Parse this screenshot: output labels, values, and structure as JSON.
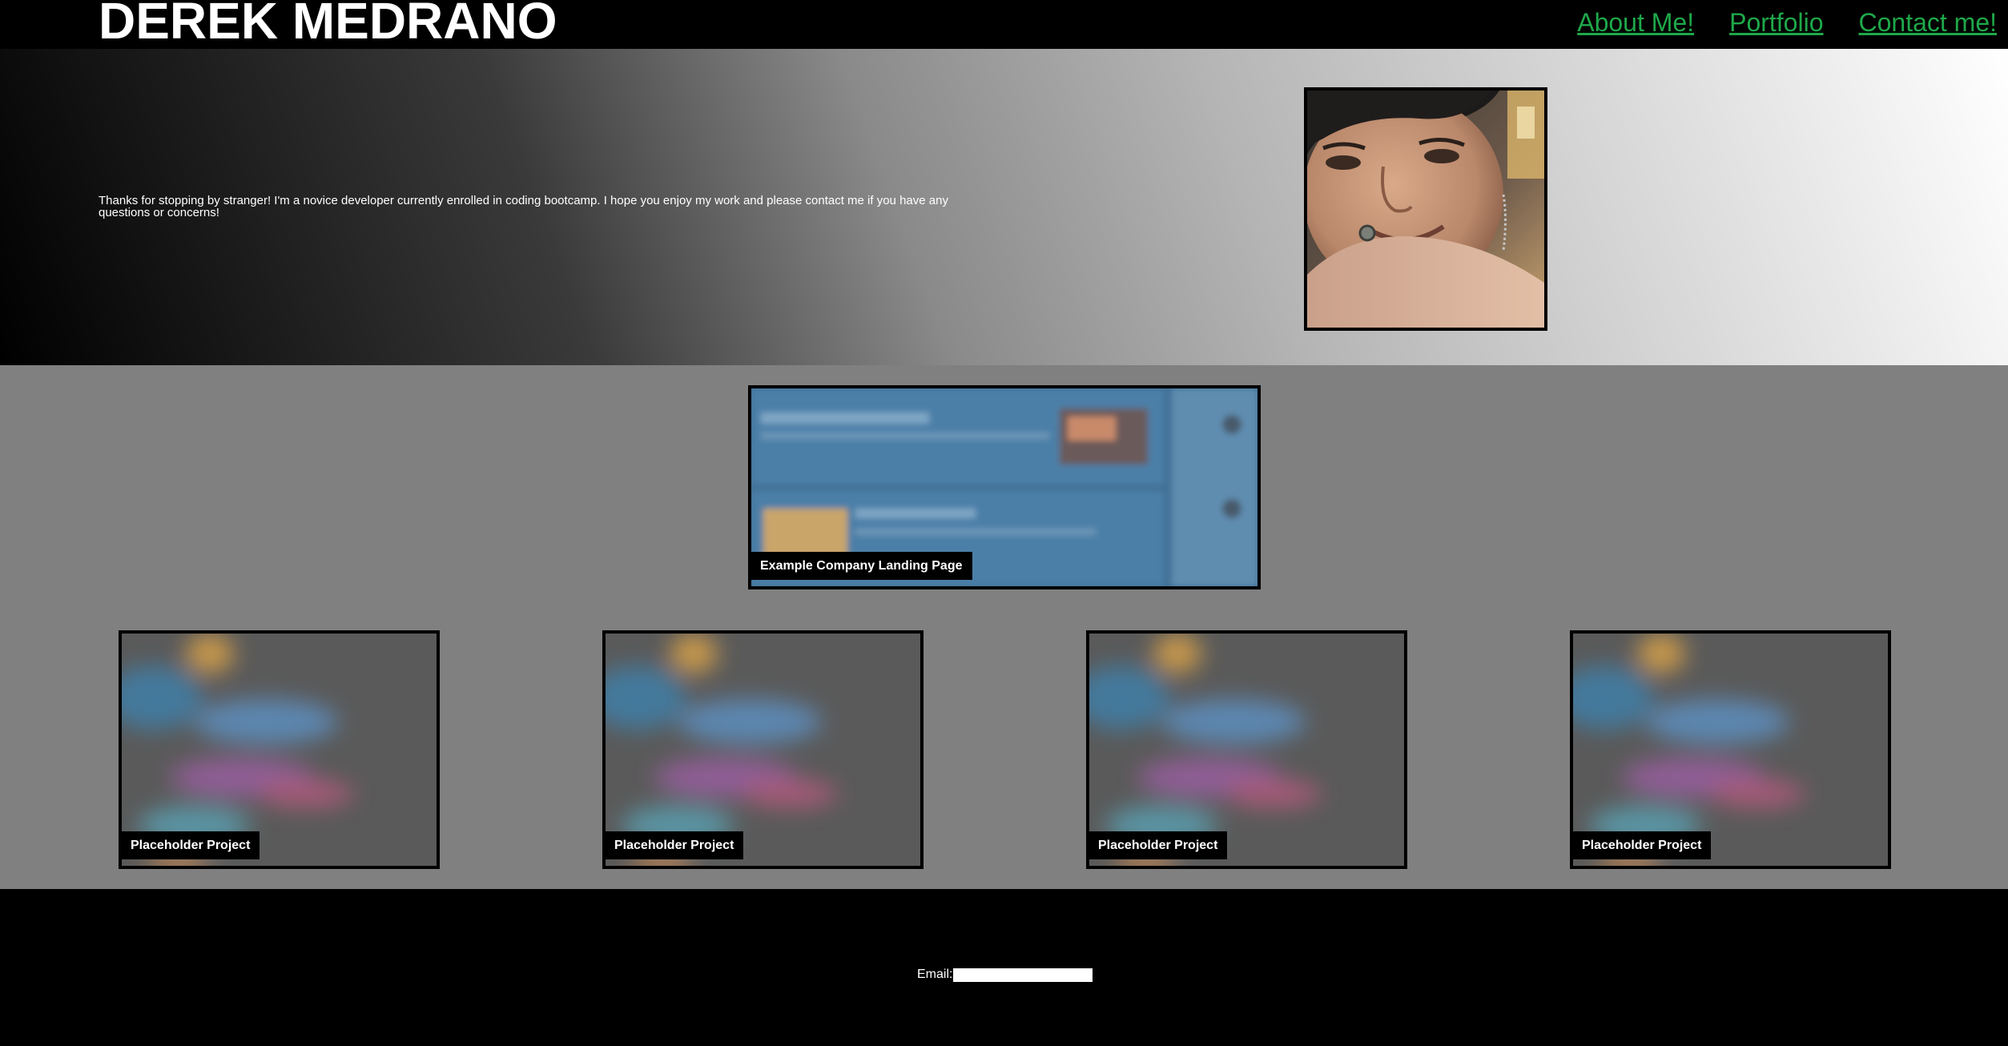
{
  "header": {
    "title": "DEREK MEDRANO",
    "nav": [
      {
        "label": "About Me!"
      },
      {
        "label": "Portfolio"
      },
      {
        "label": "Contact me!"
      }
    ]
  },
  "hero": {
    "intro": "Thanks for stopping by stranger! I'm a novice developer currently enrolled in coding bootcamp. I hope you enjoy my work and please contact me if you have any questions or concerns!"
  },
  "portfolio": {
    "featured": {
      "label": "Example Company Landing Page"
    },
    "projects": [
      {
        "label": "Placeholder Project"
      },
      {
        "label": "Placeholder Project"
      },
      {
        "label": "Placeholder Project"
      },
      {
        "label": "Placeholder Project"
      }
    ]
  },
  "footer": {
    "email_label": "Email:",
    "email_value": ""
  },
  "colors": {
    "nav_link": "#1fa84a",
    "header_bg": "#000000",
    "portfolio_bg": "#808080"
  }
}
